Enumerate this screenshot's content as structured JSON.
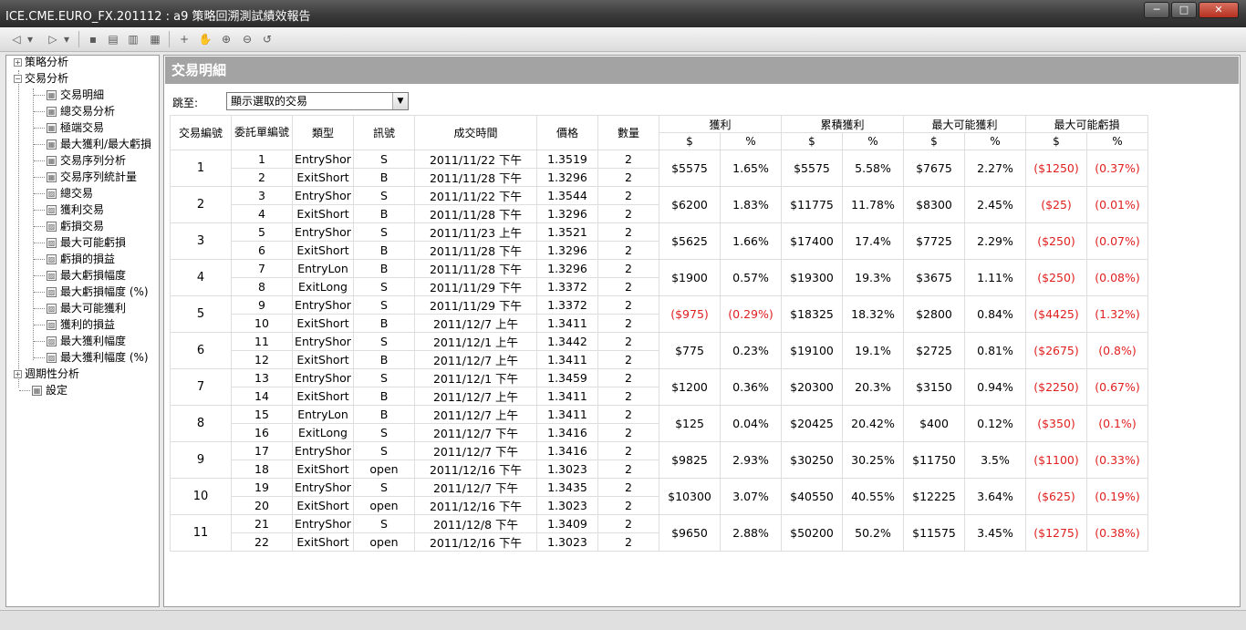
{
  "window": {
    "title": "ICE.CME.EURO_FX.201112 : a9 策略回溯測試績效報告",
    "minimize": "─",
    "maximize": "□",
    "close": "✕"
  },
  "toolbar": {
    "icons": [
      "back-icon",
      "forward-icon",
      "save-icon",
      "export-icon",
      "print-icon",
      "table-icon",
      "crosshair-icon",
      "hand-icon",
      "zoom-in-icon",
      "zoom-out-icon",
      "reset-icon"
    ],
    "glyphs": {
      "back": "◁",
      "back_dd": "▾",
      "forward": "▷",
      "forward_dd": "▾",
      "save": "▪",
      "export": "▤",
      "print": "▥",
      "table": "▦",
      "crosshair": "+",
      "hand": "✋",
      "zoom_in": "⊕",
      "zoom_out": "⊖",
      "reset": "↺"
    }
  },
  "sidebar": {
    "expand_glyph": "+",
    "collapse_glyph": "−",
    "leaf_glyph": "▦",
    "check_glyph": "▨",
    "groups": [
      {
        "label": "策略分析",
        "expanded": false
      },
      {
        "label": "交易分析",
        "expanded": true
      },
      {
        "label": "週期性分析",
        "expanded": false
      },
      {
        "label": "設定"
      }
    ],
    "items": [
      {
        "label": "交易明細",
        "icon": "table"
      },
      {
        "label": "總交易分析",
        "icon": "table"
      },
      {
        "label": "極端交易",
        "icon": "table"
      },
      {
        "label": "最大獲利/最大虧損",
        "icon": "table"
      },
      {
        "label": "交易序列分析",
        "icon": "table"
      },
      {
        "label": "交易序列統計量",
        "icon": "table"
      },
      {
        "label": "總交易",
        "icon": "chart"
      },
      {
        "label": "獲利交易",
        "icon": "chart"
      },
      {
        "label": "虧損交易",
        "icon": "chart"
      },
      {
        "label": "最大可能虧損",
        "icon": "chart"
      },
      {
        "label": "虧損的損益",
        "icon": "chart"
      },
      {
        "label": "最大虧損幅度",
        "icon": "chart"
      },
      {
        "label": "最大虧損幅度 (%)",
        "icon": "chart"
      },
      {
        "label": "最大可能獲利",
        "icon": "chart"
      },
      {
        "label": "獲利的損益",
        "icon": "chart"
      },
      {
        "label": "最大獲利幅度",
        "icon": "chart"
      },
      {
        "label": "最大獲利幅度 (%)",
        "icon": "chart"
      }
    ]
  },
  "main": {
    "header": "交易明細",
    "jump_label": "跳至:",
    "jump_value": "顯示選取的交易",
    "jump_arrow": "▼",
    "table": {
      "headers": {
        "trade_no": "交易編號",
        "order_no": "委託單編號",
        "type": "類型",
        "signal": "訊號",
        "time": "成交時間",
        "price": "價格",
        "qty": "數量",
        "groups": [
          "獲利",
          "累積獲利",
          "最大可能獲利",
          "最大可能虧損"
        ],
        "dollar": "$",
        "pct": "%"
      },
      "trades": [
        {
          "no": "1",
          "rows": [
            {
              "order": "1",
              "type": "EntryShor",
              "signal": "S",
              "time": "2011/11/22 下午",
              "price": "1.3519",
              "qty": "2"
            },
            {
              "order": "2",
              "type": "ExitShort",
              "signal": "B",
              "time": "2011/11/28 下午",
              "price": "1.3296",
              "qty": "2"
            }
          ],
          "pnl": "$5575",
          "pnl_pct": "1.65%",
          "cum": "$5575",
          "cum_pct": "5.58%",
          "mfe": "$7675",
          "mfe_pct": "2.27%",
          "mae": "($1250)",
          "mae_pct": "(0.37%)"
        },
        {
          "no": "2",
          "rows": [
            {
              "order": "3",
              "type": "EntryShor",
              "signal": "S",
              "time": "2011/11/22 下午",
              "price": "1.3544",
              "qty": "2"
            },
            {
              "order": "4",
              "type": "ExitShort",
              "signal": "B",
              "time": "2011/11/28 下午",
              "price": "1.3296",
              "qty": "2"
            }
          ],
          "pnl": "$6200",
          "pnl_pct": "1.83%",
          "cum": "$11775",
          "cum_pct": "11.78%",
          "mfe": "$8300",
          "mfe_pct": "2.45%",
          "mae": "($25)",
          "mae_pct": "(0.01%)"
        },
        {
          "no": "3",
          "rows": [
            {
              "order": "5",
              "type": "EntryShor",
              "signal": "S",
              "time": "2011/11/23 上午",
              "price": "1.3521",
              "qty": "2"
            },
            {
              "order": "6",
              "type": "ExitShort",
              "signal": "B",
              "time": "2011/11/28 下午",
              "price": "1.3296",
              "qty": "2"
            }
          ],
          "pnl": "$5625",
          "pnl_pct": "1.66%",
          "cum": "$17400",
          "cum_pct": "17.4%",
          "mfe": "$7725",
          "mfe_pct": "2.29%",
          "mae": "($250)",
          "mae_pct": "(0.07%)"
        },
        {
          "no": "4",
          "rows": [
            {
              "order": "7",
              "type": "EntryLon",
              "signal": "B",
              "time": "2011/11/28 下午",
              "price": "1.3296",
              "qty": "2"
            },
            {
              "order": "8",
              "type": "ExitLong",
              "signal": "S",
              "time": "2011/11/29 下午",
              "price": "1.3372",
              "qty": "2"
            }
          ],
          "pnl": "$1900",
          "pnl_pct": "0.57%",
          "cum": "$19300",
          "cum_pct": "19.3%",
          "mfe": "$3675",
          "mfe_pct": "1.11%",
          "mae": "($250)",
          "mae_pct": "(0.08%)"
        },
        {
          "no": "5",
          "rows": [
            {
              "order": "9",
              "type": "EntryShor",
              "signal": "S",
              "time": "2011/11/29 下午",
              "price": "1.3372",
              "qty": "2"
            },
            {
              "order": "10",
              "type": "ExitShort",
              "signal": "B",
              "time": "2011/12/7 上午",
              "price": "1.3411",
              "qty": "2"
            }
          ],
          "pnl": "($975)",
          "pnl_pct": "(0.29%)",
          "cum": "$18325",
          "cum_pct": "18.32%",
          "mfe": "$2800",
          "mfe_pct": "0.84%",
          "mae": "($4425)",
          "mae_pct": "(1.32%)"
        },
        {
          "no": "6",
          "rows": [
            {
              "order": "11",
              "type": "EntryShor",
              "signal": "S",
              "time": "2011/12/1 上午",
              "price": "1.3442",
              "qty": "2"
            },
            {
              "order": "12",
              "type": "ExitShort",
              "signal": "B",
              "time": "2011/12/7 上午",
              "price": "1.3411",
              "qty": "2"
            }
          ],
          "pnl": "$775",
          "pnl_pct": "0.23%",
          "cum": "$19100",
          "cum_pct": "19.1%",
          "mfe": "$2725",
          "mfe_pct": "0.81%",
          "mae": "($2675)",
          "mae_pct": "(0.8%)"
        },
        {
          "no": "7",
          "rows": [
            {
              "order": "13",
              "type": "EntryShor",
              "signal": "S",
              "time": "2011/12/1 下午",
              "price": "1.3459",
              "qty": "2"
            },
            {
              "order": "14",
              "type": "ExitShort",
              "signal": "B",
              "time": "2011/12/7 上午",
              "price": "1.3411",
              "qty": "2"
            }
          ],
          "pnl": "$1200",
          "pnl_pct": "0.36%",
          "cum": "$20300",
          "cum_pct": "20.3%",
          "mfe": "$3150",
          "mfe_pct": "0.94%",
          "mae": "($2250)",
          "mae_pct": "(0.67%)"
        },
        {
          "no": "8",
          "rows": [
            {
              "order": "15",
              "type": "EntryLon",
              "signal": "B",
              "time": "2011/12/7 上午",
              "price": "1.3411",
              "qty": "2"
            },
            {
              "order": "16",
              "type": "ExitLong",
              "signal": "S",
              "time": "2011/12/7 下午",
              "price": "1.3416",
              "qty": "2"
            }
          ],
          "pnl": "$125",
          "pnl_pct": "0.04%",
          "cum": "$20425",
          "cum_pct": "20.42%",
          "mfe": "$400",
          "mfe_pct": "0.12%",
          "mae": "($350)",
          "mae_pct": "(0.1%)"
        },
        {
          "no": "9",
          "rows": [
            {
              "order": "17",
              "type": "EntryShor",
              "signal": "S",
              "time": "2011/12/7 下午",
              "price": "1.3416",
              "qty": "2"
            },
            {
              "order": "18",
              "type": "ExitShort",
              "signal": "open",
              "time": "2011/12/16 下午",
              "price": "1.3023",
              "qty": "2"
            }
          ],
          "pnl": "$9825",
          "pnl_pct": "2.93%",
          "cum": "$30250",
          "cum_pct": "30.25%",
          "mfe": "$11750",
          "mfe_pct": "3.5%",
          "mae": "($1100)",
          "mae_pct": "(0.33%)"
        },
        {
          "no": "10",
          "rows": [
            {
              "order": "19",
              "type": "EntryShor",
              "signal": "S",
              "time": "2011/12/7 下午",
              "price": "1.3435",
              "qty": "2"
            },
            {
              "order": "20",
              "type": "ExitShort",
              "signal": "open",
              "time": "2011/12/16 下午",
              "price": "1.3023",
              "qty": "2"
            }
          ],
          "pnl": "$10300",
          "pnl_pct": "3.07%",
          "cum": "$40550",
          "cum_pct": "40.55%",
          "mfe": "$12225",
          "mfe_pct": "3.64%",
          "mae": "($625)",
          "mae_pct": "(0.19%)"
        },
        {
          "no": "11",
          "rows": [
            {
              "order": "21",
              "type": "EntryShor",
              "signal": "S",
              "time": "2011/12/8 下午",
              "price": "1.3409",
              "qty": "2"
            },
            {
              "order": "22",
              "type": "ExitShort",
              "signal": "open",
              "time": "2011/12/16 下午",
              "price": "1.3023",
              "qty": "2"
            }
          ],
          "pnl": "$9650",
          "pnl_pct": "2.88%",
          "cum": "$50200",
          "cum_pct": "50.2%",
          "mfe": "$11575",
          "mfe_pct": "3.45%",
          "mae": "($1275)",
          "mae_pct": "(0.38%)"
        }
      ]
    }
  },
  "colors": {
    "negative": "#e02020",
    "header_bar": "#a3a3a3"
  }
}
